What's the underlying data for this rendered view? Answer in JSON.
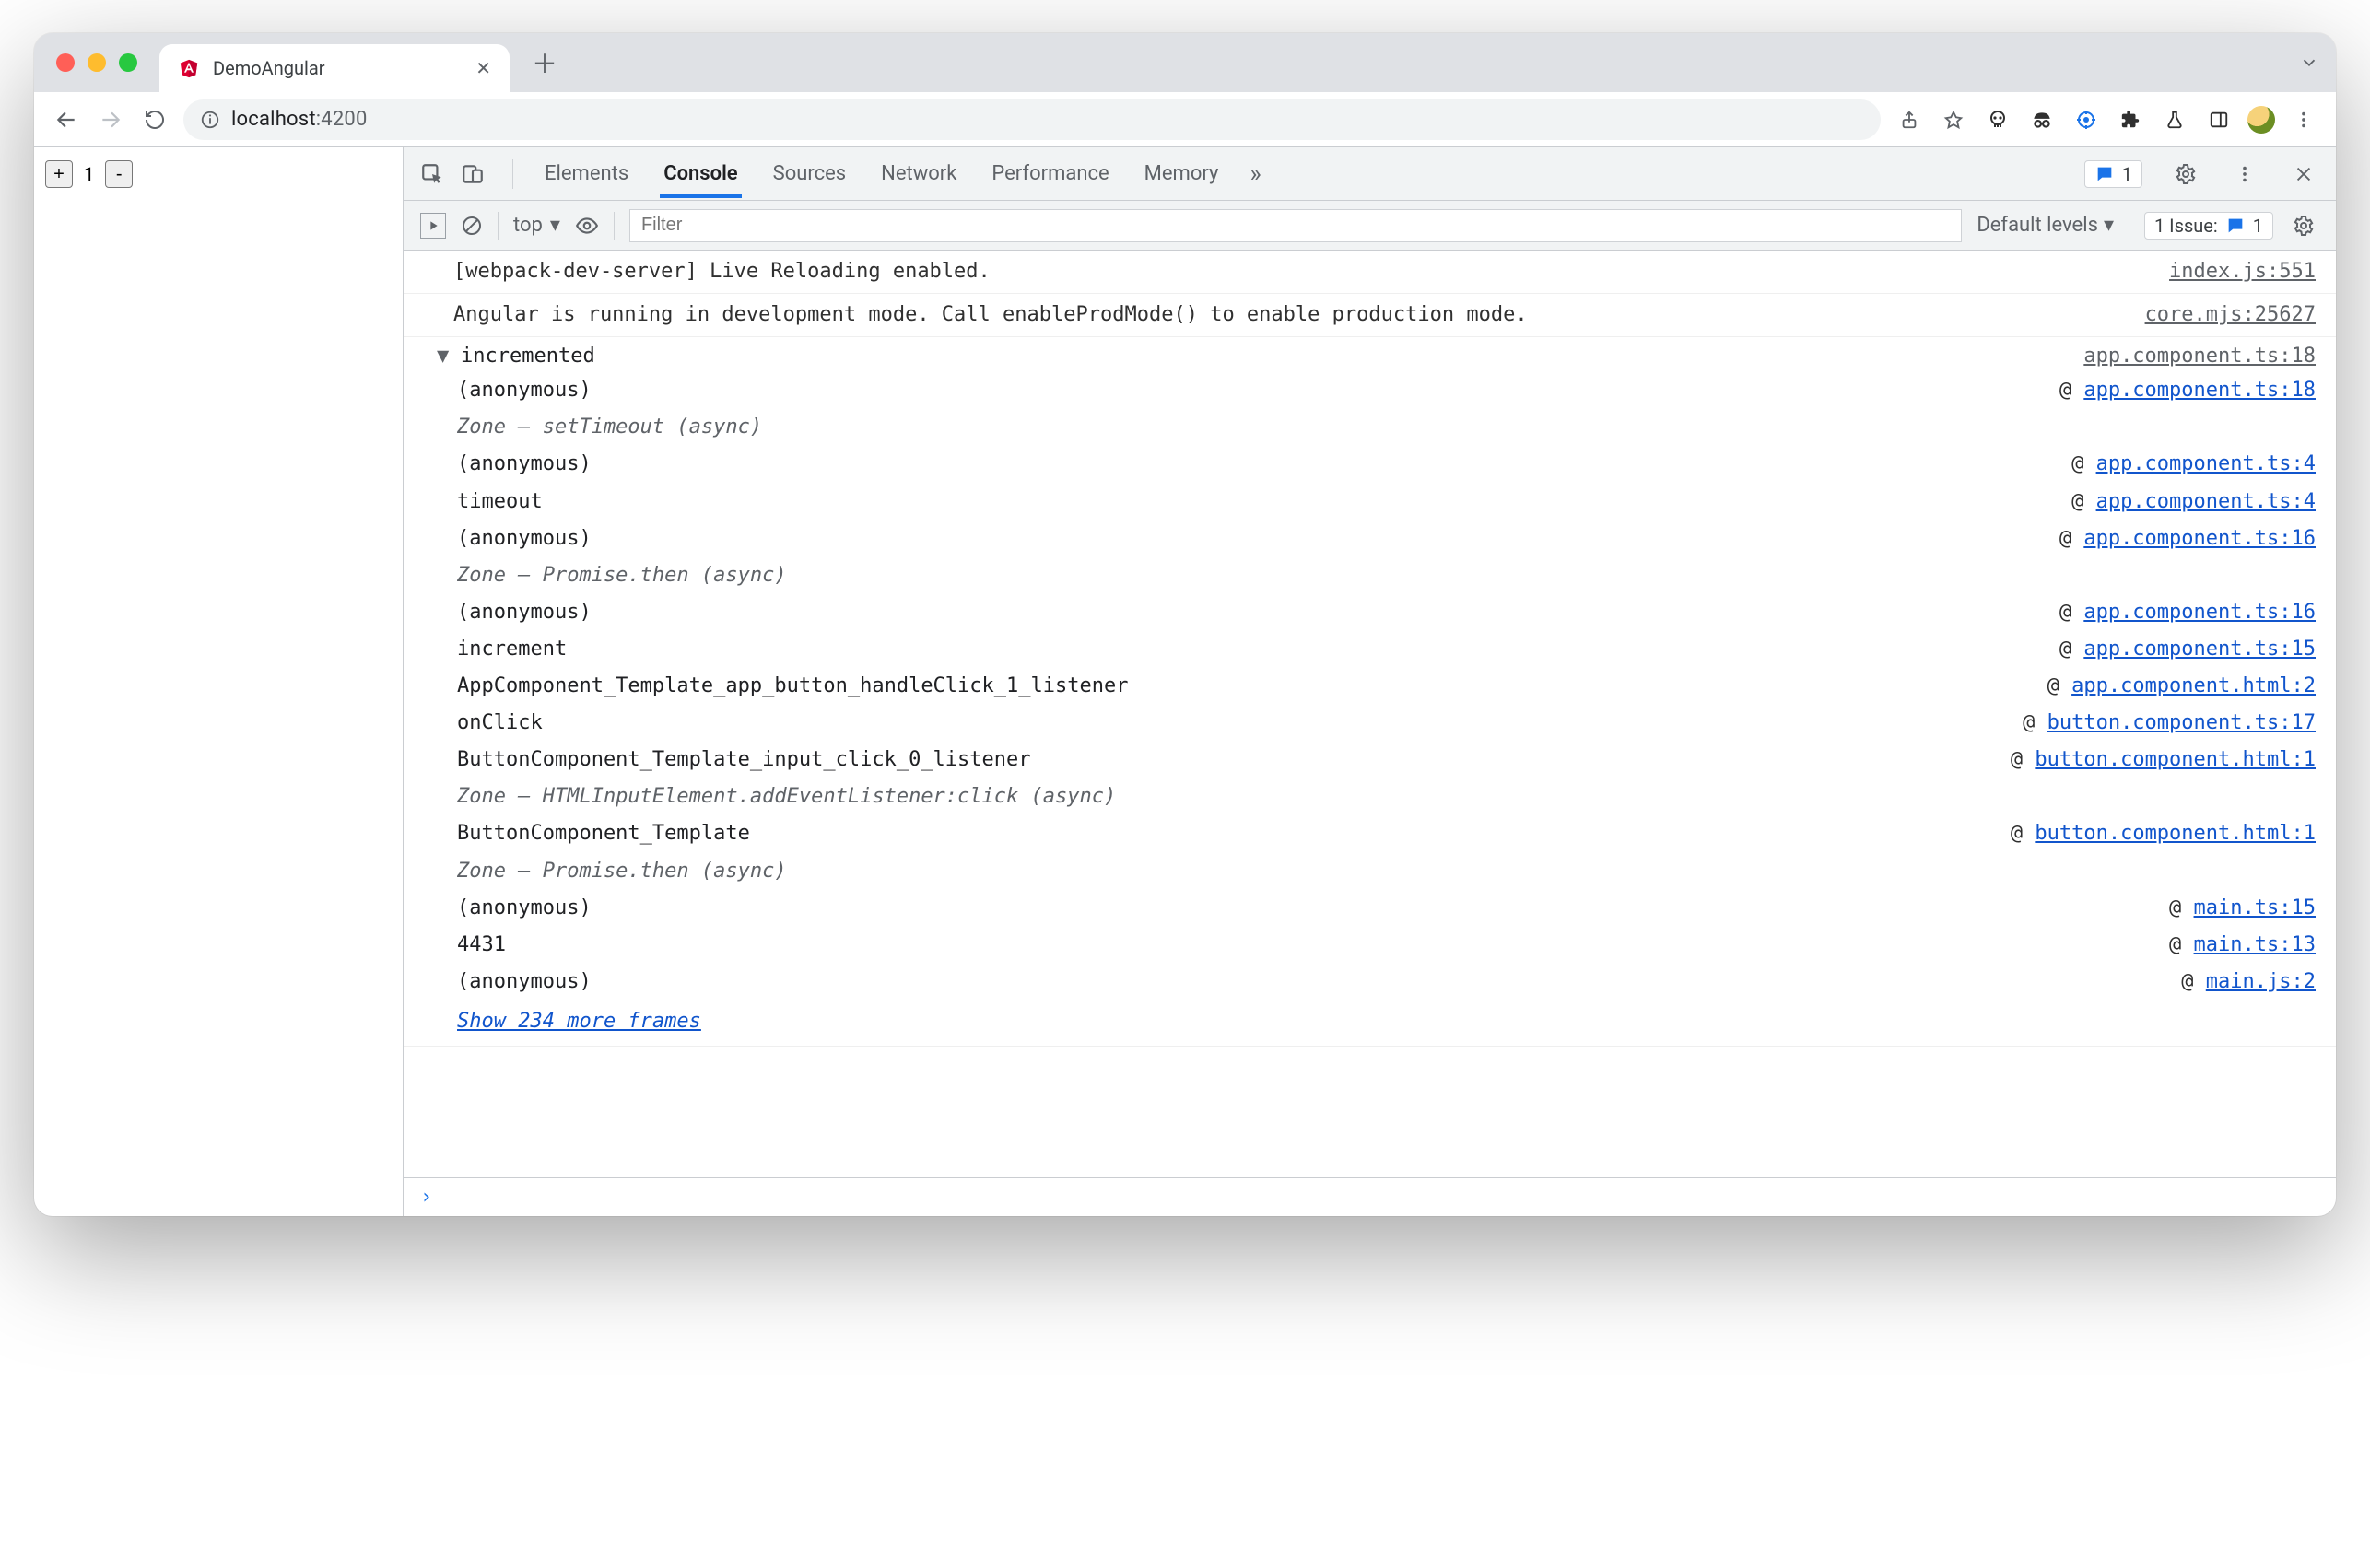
{
  "browser": {
    "tab_title": "DemoAngular",
    "url_host": "localhost",
    "url_port": ":4200",
    "messages_badge": "1"
  },
  "page": {
    "plus": "+",
    "value": "1",
    "minus": "-"
  },
  "devtools": {
    "tabs": [
      "Elements",
      "Console",
      "Sources",
      "Network",
      "Performance",
      "Memory"
    ],
    "active_tab": "Console",
    "context": "top",
    "filter_placeholder": "Filter",
    "levels": "Default levels",
    "issues_label": "1 Issue:",
    "issues_count": "1",
    "msg_count": "1"
  },
  "console": {
    "rows": [
      {
        "msg": "[webpack-dev-server] Live Reloading enabled.",
        "src": "index.js:551"
      },
      {
        "msg": "Angular is running in development mode. Call enableProdMode() to enable production mode.",
        "src": "core.mjs:25627"
      }
    ],
    "trace": {
      "label": "incremented",
      "src": "app.component.ts:18",
      "frames": [
        {
          "fn": "(anonymous)",
          "loc": "app.component.ts:18"
        },
        {
          "fn": "Zone — setTimeout (async)",
          "zone": true
        },
        {
          "fn": "(anonymous)",
          "loc": "app.component.ts:4"
        },
        {
          "fn": "timeout",
          "loc": "app.component.ts:4"
        },
        {
          "fn": "(anonymous)",
          "loc": "app.component.ts:16"
        },
        {
          "fn": "Zone — Promise.then (async)",
          "zone": true
        },
        {
          "fn": "(anonymous)",
          "loc": "app.component.ts:16"
        },
        {
          "fn": "increment",
          "loc": "app.component.ts:15"
        },
        {
          "fn": "AppComponent_Template_app_button_handleClick_1_listener",
          "loc": "app.component.html:2"
        },
        {
          "fn": "onClick",
          "loc": "button.component.ts:17"
        },
        {
          "fn": "ButtonComponent_Template_input_click_0_listener",
          "loc": "button.component.html:1"
        },
        {
          "fn": "Zone — HTMLInputElement.addEventListener:click (async)",
          "zone": true
        },
        {
          "fn": "ButtonComponent_Template",
          "loc": "button.component.html:1"
        },
        {
          "fn": "Zone — Promise.then (async)",
          "zone": true
        },
        {
          "fn": "(anonymous)",
          "loc": "main.ts:15"
        },
        {
          "fn": "4431",
          "loc": "main.ts:13"
        },
        {
          "fn": "(anonymous)",
          "loc": "main.js:2"
        }
      ],
      "show_more": "Show 234 more frames"
    },
    "prompt": "›"
  }
}
